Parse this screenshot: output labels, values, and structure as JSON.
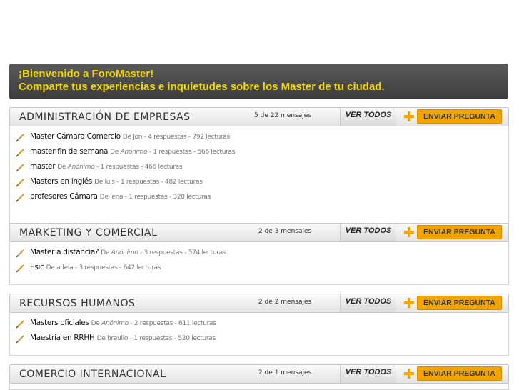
{
  "banner": {
    "line1": "¡Bienvenido a ForoMaster!",
    "line2": "Comparte tus experiencias e inquietudes sobre los Master de tu ciudad."
  },
  "labels": {
    "ver_todos": "VER TODOS",
    "enviar_pregunta": "ENVIAR PREGUNTA",
    "de": "De"
  },
  "sections": [
    {
      "title": "ADMINISTRACIÓN DE EMPRESAS",
      "count": "5 de 22 mensajes",
      "posts": [
        {
          "title": "Master Cámara Comercio",
          "author": "Jon",
          "stats": "- 4 respuestas - 792 lecturas"
        },
        {
          "title": "master fin de semana",
          "author": "Anónimo",
          "stats": "- 1 respuestas - 566 lecturas"
        },
        {
          "title": "master",
          "author": "Anónimo",
          "stats": "- 1 respuestas - 466 lecturas"
        },
        {
          "title": "Masters en inglés",
          "author": "luis",
          "stats": "- 1 respuestas - 482 lecturas"
        },
        {
          "title": "profesores Cámara",
          "author": "lena",
          "stats": "- 1 respuestas - 320 lecturas"
        }
      ]
    },
    {
      "title": "MARKETING Y COMERCIAL",
      "count": "2 de 3 mensajes",
      "posts": [
        {
          "title": "Master a distancia?",
          "author": "Anónimo",
          "stats": "- 3 respuestas - 574 lecturas"
        },
        {
          "title": "Esic",
          "author": "adela",
          "stats": "- 3 respuestas - 642 lecturas"
        }
      ]
    },
    {
      "title": "RECURSOS HUMANOS",
      "count": "2 de 2 mensajes",
      "posts": [
        {
          "title": "Masters oficiales",
          "author": "Anónimo",
          "stats": "- 2 respuestas - 611 lecturas"
        },
        {
          "title": "Maestria en RRHH",
          "author": "braulio",
          "stats": "- 1 respuestas - 520 lecturas"
        }
      ]
    },
    {
      "title": "COMERCIO INTERNACIONAL",
      "count": "2 de 1 mensajes",
      "posts": []
    }
  ]
}
